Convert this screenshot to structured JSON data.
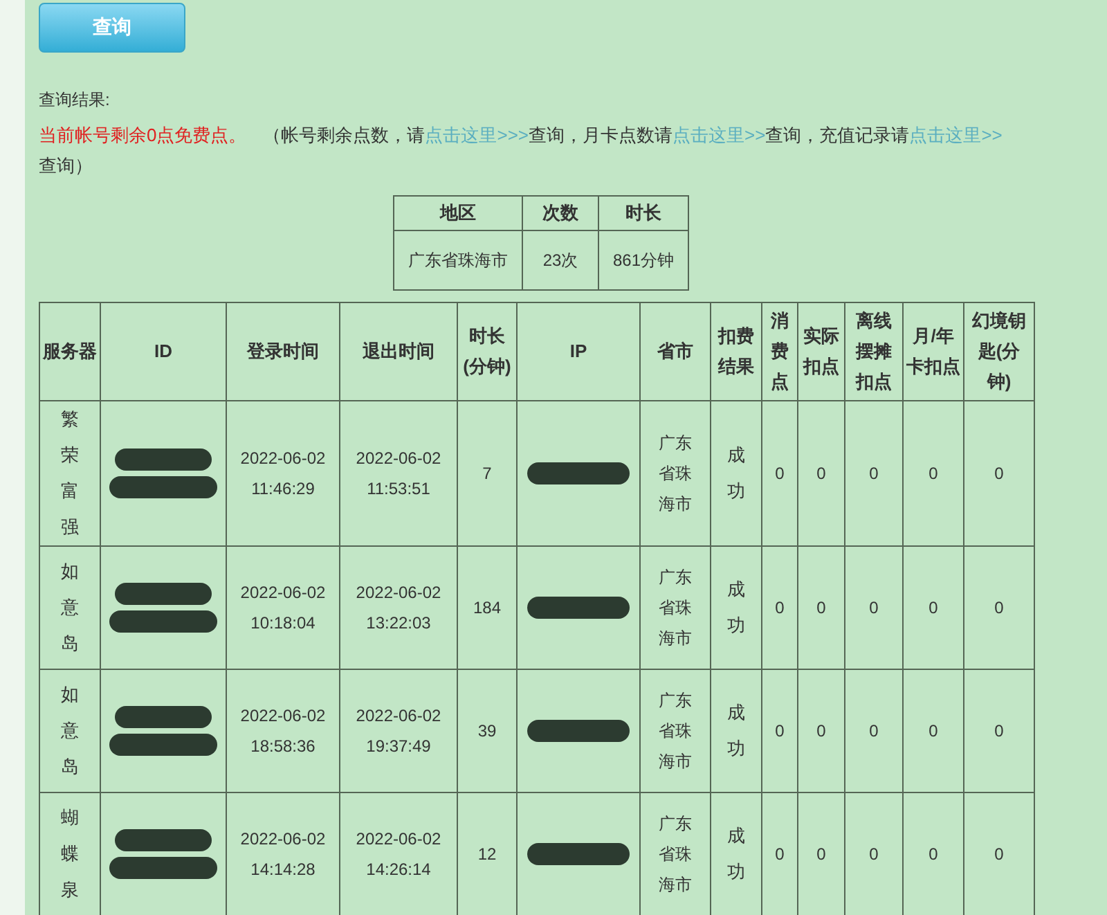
{
  "query_button": "查询",
  "result_label": "查询结果:",
  "notice": [
    {
      "kind": "alert",
      "text": "当前帐号剩余0点免费点。"
    },
    {
      "kind": "plain",
      "text": "（帐号剩余点数，请"
    },
    {
      "kind": "link",
      "text": "点击这里>>>"
    },
    {
      "kind": "plain",
      "text": "查询，月卡点数请"
    },
    {
      "kind": "link",
      "text": "点击这里>>"
    },
    {
      "kind": "plain",
      "text": "查询，充值记录请"
    },
    {
      "kind": "link",
      "text": "点击这里>>"
    },
    {
      "kind": "plain",
      "text": "查询）"
    }
  ],
  "summary_table": {
    "columns": [
      "地区",
      "次数",
      "时长"
    ],
    "rows": [
      [
        "广东省珠海市",
        "23次",
        "861分钟"
      ]
    ]
  },
  "records_table": {
    "columns": [
      "服务器",
      "ID",
      "登录时间",
      "退出时间",
      "时长(分钟)",
      "IP",
      "省市",
      "扣费结果",
      "消费点",
      "实际扣点",
      "离线摆摊扣点",
      "月/年卡扣点",
      "幻境钥匙(分钟)"
    ],
    "rows": [
      {
        "server": "繁荣富强",
        "login": "2022-06-02 11:46:29",
        "logout": "2022-06-02 11:53:51",
        "minutes": "7",
        "province": "广东省珠海市",
        "result": "成功",
        "points": [
          "0",
          "0",
          "0",
          "0",
          "0"
        ]
      },
      {
        "server": "如意岛",
        "login": "2022-06-02 10:18:04",
        "logout": "2022-06-02 13:22:03",
        "minutes": "184",
        "province": "广东省珠海市",
        "result": "成功",
        "points": [
          "0",
          "0",
          "0",
          "0",
          "0"
        ]
      },
      {
        "server": "如意岛",
        "login": "2022-06-02 18:58:36",
        "logout": "2022-06-02 19:37:49",
        "minutes": "39",
        "province": "广东省珠海市",
        "result": "成功",
        "points": [
          "0",
          "0",
          "0",
          "0",
          "0"
        ]
      },
      {
        "server": "蝴蝶泉",
        "login": "2022-06-02 14:14:28",
        "logout": "2022-06-02 14:26:14",
        "minutes": "12",
        "province": "广东省珠海市",
        "result": "成功",
        "points": [
          "0",
          "0",
          "0",
          "0",
          "0"
        ]
      }
    ]
  }
}
